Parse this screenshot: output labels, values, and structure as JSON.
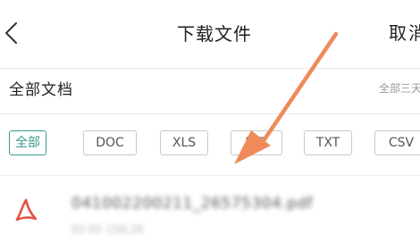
{
  "header": {
    "title": "下载文件",
    "cancel_label": "取消"
  },
  "section": {
    "title": "全部文档",
    "sort_label": "全部三天"
  },
  "filters": [
    {
      "label": "全部",
      "active": true
    },
    {
      "label": "DOC",
      "active": false
    },
    {
      "label": "XLS",
      "active": false
    },
    {
      "label": "PPT",
      "active": false
    },
    {
      "label": "TXT",
      "active": false
    },
    {
      "label": "CSV",
      "active": false
    }
  ],
  "files": [
    {
      "name": "04100220021​1_26575304.pdf",
      "meta": "02-05 158.2K",
      "icon": "pdf-icon"
    }
  ],
  "colors": {
    "accent": "#3a9c8f",
    "pdf_red": "#e2534a",
    "annotation_arrow": "#ef8a5a"
  }
}
